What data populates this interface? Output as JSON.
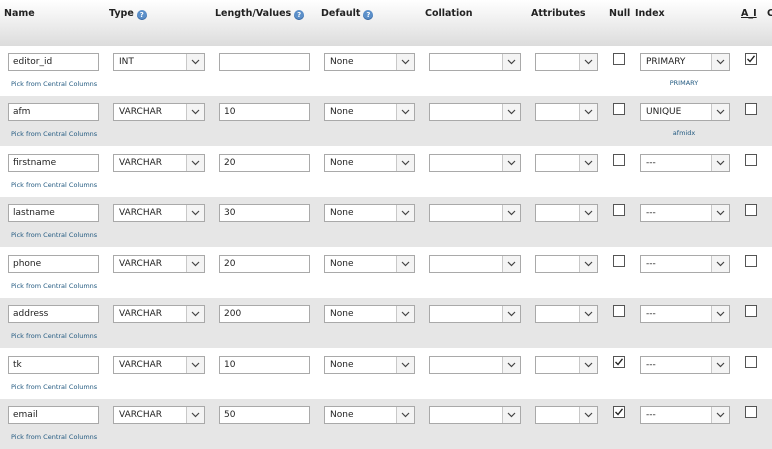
{
  "header": {
    "name": "Name",
    "type": "Type",
    "length": "Length/Values",
    "default": "Default",
    "collation": "Collation",
    "attributes": "Attributes",
    "null": "Null",
    "index": "Index",
    "ai": "A_I",
    "comments_partial": "C"
  },
  "pick_label": "Pick from Central Columns",
  "rows": [
    {
      "name": "editor_id",
      "type": "INT",
      "length": "",
      "default": "None",
      "collation": "",
      "attributes": "",
      "null": false,
      "index": "PRIMARY",
      "index_name": "PRIMARY",
      "ai": true
    },
    {
      "name": "afm",
      "type": "VARCHAR",
      "length": "10",
      "default": "None",
      "collation": "",
      "attributes": "",
      "null": false,
      "index": "UNIQUE",
      "index_name": "afmidx",
      "ai": false
    },
    {
      "name": "firstname",
      "type": "VARCHAR",
      "length": "20",
      "default": "None",
      "collation": "",
      "attributes": "",
      "null": false,
      "index": "---",
      "index_name": "",
      "ai": false
    },
    {
      "name": "lastname",
      "type": "VARCHAR",
      "length": "30",
      "default": "None",
      "collation": "",
      "attributes": "",
      "null": false,
      "index": "---",
      "index_name": "",
      "ai": false
    },
    {
      "name": "phone",
      "type": "VARCHAR",
      "length": "20",
      "default": "None",
      "collation": "",
      "attributes": "",
      "null": false,
      "index": "---",
      "index_name": "",
      "ai": false
    },
    {
      "name": "address",
      "type": "VARCHAR",
      "length": "200",
      "default": "None",
      "collation": "",
      "attributes": "",
      "null": false,
      "index": "---",
      "index_name": "",
      "ai": false
    },
    {
      "name": "tk",
      "type": "VARCHAR",
      "length": "10",
      "default": "None",
      "collation": "",
      "attributes": "",
      "null": true,
      "index": "---",
      "index_name": "",
      "ai": false
    },
    {
      "name": "email",
      "type": "VARCHAR",
      "length": "50",
      "default": "None",
      "collation": "",
      "attributes": "",
      "null": true,
      "index": "---",
      "index_name": "",
      "ai": false
    }
  ],
  "colors": {
    "row_alt": "#e6e6e6",
    "link": "#235a81",
    "help_icon": "#5b8fc9"
  }
}
